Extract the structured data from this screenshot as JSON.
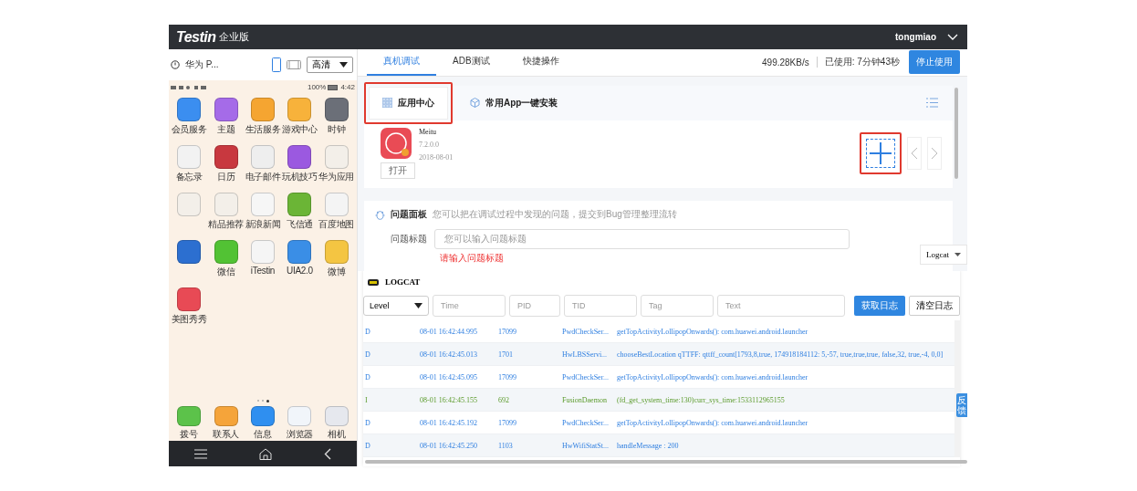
{
  "header": {
    "logo": "Testin",
    "edition": "企业版",
    "user": "tongmiao"
  },
  "device": {
    "name": "华为 P...",
    "quality": "高清",
    "portrait_selected": true
  },
  "phone": {
    "battery": "100%",
    "clock": "4:42",
    "apps": [
      {
        "label": "会员服务",
        "color": "#3b8ef0"
      },
      {
        "label": "主题",
        "color": "#a56be8"
      },
      {
        "label": "生活服务",
        "color": "#f5a531"
      },
      {
        "label": "游戏中心",
        "color": "#f7b23b"
      },
      {
        "label": "时钟",
        "color": "#6b6f78"
      },
      {
        "label": "备忘录",
        "color": "#f2f2f2"
      },
      {
        "label": "日历",
        "color": "#c8383f"
      },
      {
        "label": "电子邮件",
        "color": "#eeeeee"
      },
      {
        "label": "玩机技巧",
        "color": "#9b59e0"
      },
      {
        "label": "华为应用",
        "color": "#f3efe9"
      },
      {
        "color": "#f3efe9"
      },
      {
        "label": "精品推荐",
        "color": "#f3efe9"
      },
      {
        "label": "新浪新闻",
        "color": "#f6f6f6"
      },
      {
        "label": "飞信通",
        "color": "#6bb536"
      },
      {
        "label": "百度地图",
        "color": "#f4f4f4"
      },
      {
        "color": "#2c6fd0"
      },
      {
        "label": "微信",
        "color": "#52c234"
      },
      {
        "label": "iTestin",
        "color": "#f5f5f5"
      },
      {
        "label": "UIA2.0",
        "color": "#3a8ee6"
      },
      {
        "label": "微博",
        "color": "#f4c542"
      },
      {
        "label": "美图秀秀",
        "color": "#e84a55"
      }
    ],
    "dock": [
      {
        "label": "拨号",
        "color": "#5cc24a"
      },
      {
        "label": "联系人",
        "color": "#f5a43a"
      },
      {
        "label": "信息",
        "color": "#2f8ff0"
      },
      {
        "label": "浏览器",
        "color": "#f1f5fa"
      },
      {
        "label": "相机",
        "color": "#e6e8ee"
      }
    ]
  },
  "tabs": [
    {
      "label": "真机调试",
      "selected": true
    },
    {
      "label": "ADB测试",
      "selected": false
    },
    {
      "label": "快捷操作",
      "selected": false
    }
  ],
  "speed": "499.28KB/s",
  "used": "已使用: 7分钟43秒",
  "stop_button": "停止使用",
  "app_center": {
    "tabs": [
      {
        "label": "应用中心",
        "selected": true,
        "highlighted": true
      },
      {
        "label": "常用App一键安装",
        "selected": false,
        "highlighted": false
      }
    ],
    "apps": [
      {
        "name": "Meitu",
        "version": "7.2.0.0",
        "date": "2018-08-01",
        "open": "打开"
      }
    ],
    "add_highlighted": true
  },
  "issue_panel": {
    "title": "问题面板",
    "hint": "您可以把在调试过程中发现的问题，提交到Bug管理整理流转",
    "field_label": "问题标题",
    "placeholder": "您可以输入问题标题",
    "error": "请输入问题标题"
  },
  "logcat_dropdown": "Logcat",
  "logcat": {
    "title": "LOGCAT",
    "level_select": "Level",
    "filters": [
      {
        "placeholder": "Time"
      },
      {
        "placeholder": "PID"
      },
      {
        "placeholder": "TID"
      },
      {
        "placeholder": "Tag"
      },
      {
        "placeholder": "Text"
      }
    ],
    "fetch_button": "获取日志",
    "clear_button": "清空日志",
    "rows": [
      {
        "level": "D",
        "time": "08-01 16:42:44.995",
        "pid": "17099",
        "tag": "PwdCheckSer...",
        "message": "getTopActivityLollipopOnwards(): com.huawei.android.launcher"
      },
      {
        "level": "D",
        "time": "08-01 16:42:45.013",
        "pid": "1701",
        "tag": "HwLBSServi...",
        "message": "chooseBestLocation qTTFF: qttff_count[1793,8,true, 174918184112: 5,-57, true,true,true, false,32, true,-4, 0,0]"
      },
      {
        "level": "D",
        "time": "08-01 16:42:45.095",
        "pid": "17099",
        "tag": "PwdCheckSer...",
        "message": "getTopActivityLollipopOnwards(): com.huawei.android.launcher"
      },
      {
        "level": "I",
        "time": "08-01 16:42:45.155",
        "pid": "692",
        "tag": "FusionDaemon",
        "message": "(fd_get_system_time:130)curr_sys_time:1533112965155"
      },
      {
        "level": "D",
        "time": "08-01 16:42:45.192",
        "pid": "17099",
        "tag": "PwdCheckSer...",
        "message": "getTopActivityLollipopOnwards(): com.huawei.android.launcher"
      },
      {
        "level": "D",
        "time": "08-01 16:42:45.250",
        "pid": "1103",
        "tag": "HwWifiStatSt...",
        "message": "handleMessage : 200"
      }
    ]
  },
  "feedback": "反馈"
}
